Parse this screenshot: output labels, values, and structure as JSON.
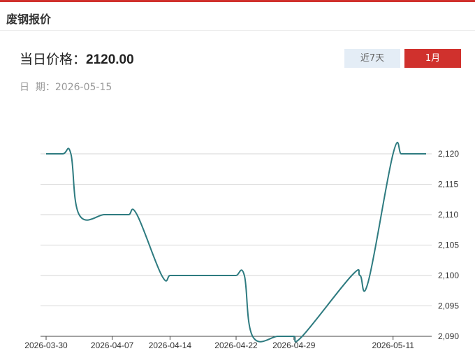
{
  "header": {
    "title": "废钢报价"
  },
  "price": {
    "label": "当日价格：",
    "value": "2120.00"
  },
  "date": {
    "text": "日  期：2026-05-15"
  },
  "range_buttons": {
    "seven_days": "近7天",
    "one_month": "1月"
  },
  "colors": {
    "accent": "#d0312d",
    "line": "#2e7b80"
  },
  "chart_data": {
    "type": "line",
    "x_ticks": [
      "2026-03-30",
      "2026-04-07",
      "2026-04-14",
      "2026-04-22",
      "2026-04-29",
      "2026-05-11"
    ],
    "y_ticks": [
      "2,090",
      "2,095",
      "2,100",
      "2,105",
      "2,110",
      "2,115",
      "2,120"
    ],
    "ylim": [
      2090,
      2120
    ],
    "grid": true,
    "series": [
      {
        "x": [
          "2026-03-30",
          "2026-04-01",
          "2026-04-02",
          "2026-04-03",
          "2026-04-06",
          "2026-04-07",
          "2026-04-08",
          "2026-04-09",
          "2026-04-10",
          "2026-04-13",
          "2026-04-14",
          "2026-04-15",
          "2026-04-16",
          "2026-04-17",
          "2026-04-20",
          "2026-04-21",
          "2026-04-22",
          "2026-04-23",
          "2026-04-24",
          "2026-04-27",
          "2026-04-28",
          "2026-04-29",
          "2026-04-30",
          "2026-05-06",
          "2026-05-07",
          "2026-05-08",
          "2026-05-11",
          "2026-05-12",
          "2026-05-13",
          "2026-05-14",
          "2026-05-15"
        ],
        "values": [
          2120,
          2120,
          2120,
          2110,
          2110,
          2110,
          2110,
          2110,
          2110,
          2100,
          2100,
          2100,
          2100,
          2100,
          2100,
          2100,
          2100,
          2100,
          2090,
          2090,
          2090,
          2090,
          2090,
          2100,
          2100,
          2099,
          2120,
          2120,
          2120,
          2120,
          2120
        ]
      }
    ]
  }
}
